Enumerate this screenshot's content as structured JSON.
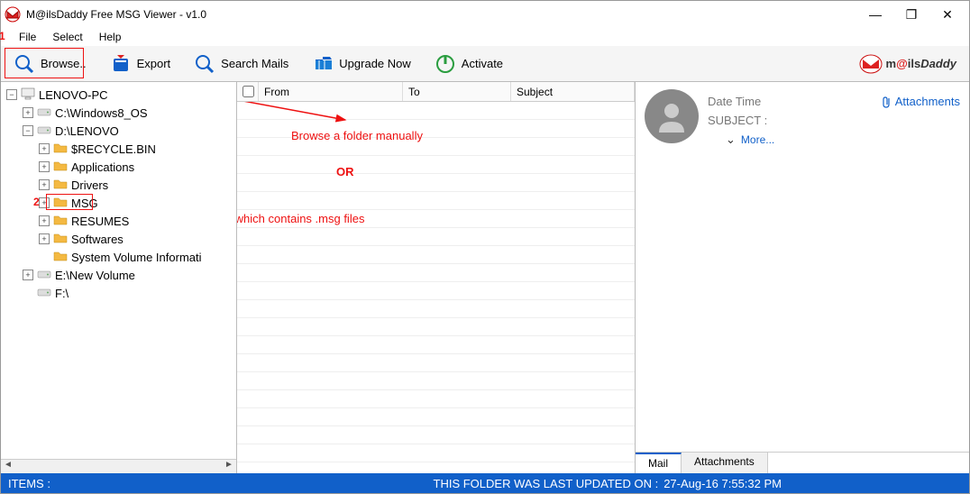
{
  "title": "M@ilsDaddy Free MSG Viewer - v1.0",
  "menu": {
    "file": "File",
    "select": "Select",
    "help": "Help"
  },
  "toolbar": {
    "browse": "Browse..",
    "export": "Export",
    "search": "Search Mails",
    "upgrade": "Upgrade Now",
    "activate": "Activate"
  },
  "logo": {
    "pre": "m",
    "at": "@",
    "mid": "ils",
    "suf": "Daddy"
  },
  "tree": [
    {
      "level": 0,
      "exp": "−",
      "icon": "pc",
      "label": "LENOVO-PC"
    },
    {
      "level": 1,
      "exp": "+",
      "icon": "drive",
      "label": "C:\\Windows8_OS"
    },
    {
      "level": 1,
      "exp": "−",
      "icon": "drive",
      "label": "D:\\LENOVO"
    },
    {
      "level": 2,
      "exp": "+",
      "icon": "folder",
      "label": "$RECYCLE.BIN"
    },
    {
      "level": 2,
      "exp": "+",
      "icon": "folder",
      "label": "Applications"
    },
    {
      "level": 2,
      "exp": "+",
      "icon": "folder",
      "label": "Drivers"
    },
    {
      "level": 2,
      "exp": "+",
      "icon": "folder",
      "label": "MSG"
    },
    {
      "level": 2,
      "exp": "+",
      "icon": "folder",
      "label": "RESUMES"
    },
    {
      "level": 2,
      "exp": "+",
      "icon": "folder",
      "label": "Softwares"
    },
    {
      "level": 2,
      "exp": "",
      "icon": "folder",
      "label": "System Volume Informati"
    },
    {
      "level": 1,
      "exp": "+",
      "icon": "drive",
      "label": "E:\\New Volume"
    },
    {
      "level": 1,
      "exp": "",
      "icon": "drive",
      "label": "F:\\"
    }
  ],
  "list": {
    "columns": {
      "from": "From",
      "to": "To",
      "subject": "Subject"
    }
  },
  "preview": {
    "datetime_label": "Date Time",
    "subject_label": "SUBJECT :",
    "more": "More...",
    "attachments": "Attachments",
    "tabs": {
      "mail": "Mail",
      "attach": "Attachments"
    }
  },
  "status": {
    "items": "ITEMS :",
    "updated_label": "THIS FOLDER WAS LAST UPDATED ON :",
    "updated_value": "27-Aug-16 7:55:32 PM"
  },
  "annotations": {
    "n1": "1",
    "n2": "2",
    "browse_text": "Browse a folder manually",
    "or": "OR",
    "msg_text": "Click on the folder which contains .msg files"
  }
}
